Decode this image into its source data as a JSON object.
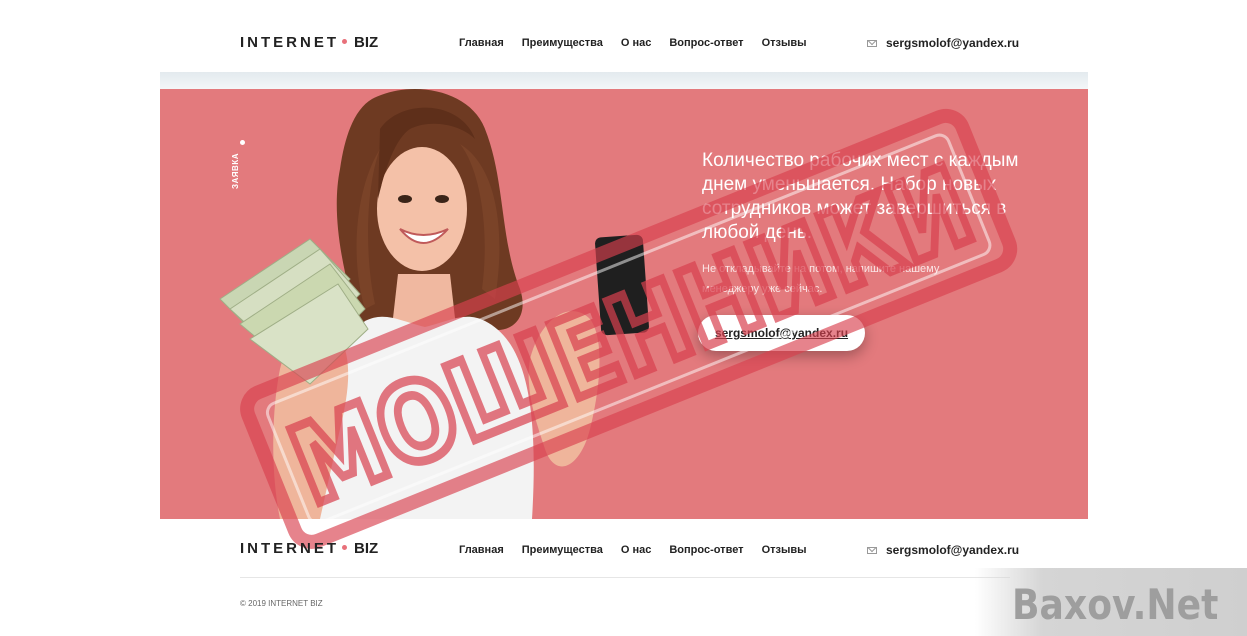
{
  "header": {
    "logo_left": "INTERNET",
    "logo_right": "BIZ",
    "nav": [
      "Главная",
      "Преимущества",
      "О нас",
      "Вопрос-ответ",
      "Отзывы"
    ],
    "email": "sergsmolof@yandex.ru"
  },
  "hero": {
    "side_label": "ЗАЯВКА",
    "headline": "Количество рабочих мест с каждым днем уменьшается. Набор новых сотрудников может завершиться в любой день.",
    "subtext": "Не откладывайте на потом, напишите нашему менеджеру уже сейчас.",
    "cta_email": "sergsmolof@yandex.ru",
    "background_color": "#e37a7d"
  },
  "stamp": {
    "text": "МОШЕННИКИ",
    "color": "#d9414f"
  },
  "footer": {
    "logo_left": "INTERNET",
    "logo_right": "BIZ",
    "nav": [
      "Главная",
      "Преимущества",
      "О нас",
      "Вопрос-ответ",
      "Отзывы"
    ],
    "email": "sergsmolof@yandex.ru",
    "copyright": "© 2019 INTERNET BIZ"
  },
  "watermark": {
    "text": "Baxov.Net"
  }
}
